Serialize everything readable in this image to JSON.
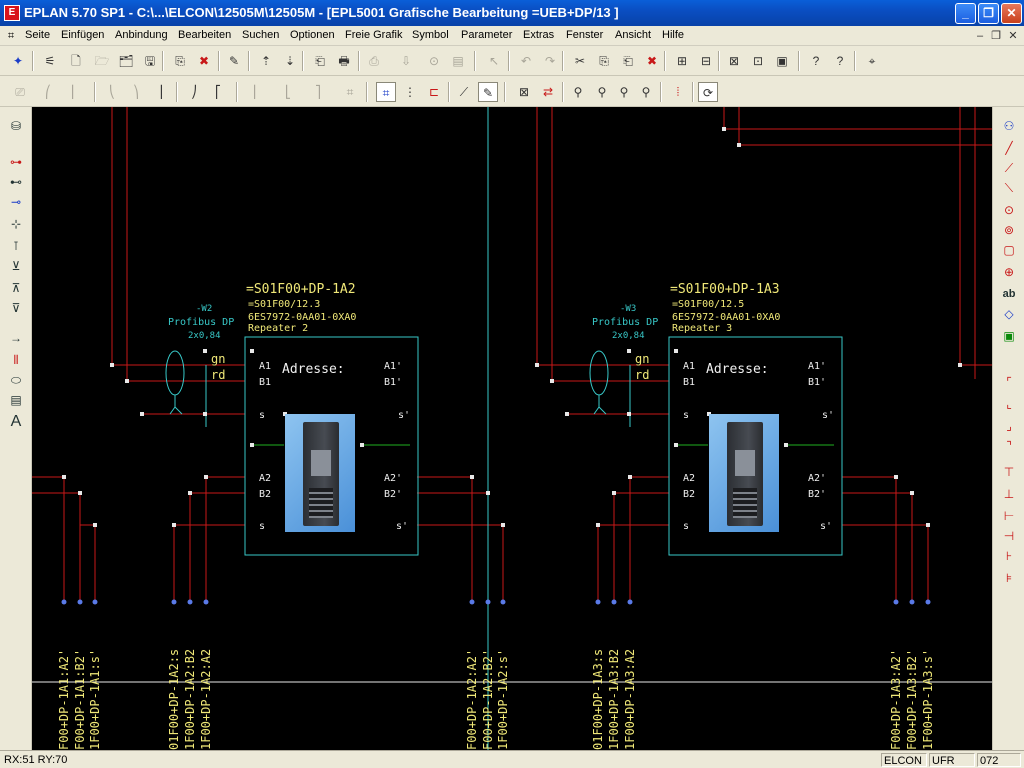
{
  "window": {
    "title": "EPLAN 5.70 SP1 - C:\\...\\ELCON\\12505M\\12505M - [EPL5001 Grafische Bearbeitung =UEB+DP/13    ]",
    "app_icon": "eplan-app-icon",
    "controls": {
      "minimize": "_",
      "maximize": "❐",
      "close": "✕"
    }
  },
  "menubar": {
    "items": [
      "Seite",
      "Einfügen",
      "Anbindung",
      "Bearbeiten",
      "Suchen",
      "Optionen",
      "Freie Grafik",
      "Symbol",
      "Parameter",
      "Extras",
      "Fenster",
      "Ansicht",
      "Hilfe"
    ],
    "mdi_controls": {
      "minimize": "–",
      "restore": "❐",
      "close": "✕"
    }
  },
  "toolbar1": {
    "buttons": [
      "✦",
      "⚟",
      "🗋",
      "🗁",
      "🗂",
      "🖫",
      "⎘",
      "✖",
      "✎",
      "⇡",
      "⇣",
      "⎗",
      "🖶",
      "⎙",
      "⇩",
      "⊙",
      "▤",
      "↖",
      "↶",
      "↷",
      "✂",
      "⎘",
      "⎗",
      "✖",
      "⊞",
      "⊟",
      "⊠",
      "⊡",
      "▣",
      "?",
      "?",
      "⌖"
    ]
  },
  "toolbar2": {
    "buttons": [
      "⎚",
      "⎛",
      "⎜",
      "⎝",
      "⎞",
      "⎟",
      "⎠",
      "⎡",
      "⎢",
      "⎣",
      "⎤",
      "⌗",
      "⋮",
      "⊏",
      "⟋",
      "✎",
      "⊠",
      "⇄",
      "⚲",
      "⚲",
      "⚲",
      "⚲",
      "⦙",
      "⟳"
    ]
  },
  "left_tools": [
    "⛁",
    "⊶",
    "⊷",
    "⊸",
    "⊹",
    "⊺",
    "⊻",
    "⊼",
    "⊽",
    "→",
    "⫴",
    "⬭",
    "▤",
    "A"
  ],
  "right_tools": [
    "⚇",
    "╱",
    "⟋",
    "⟍",
    "⊙",
    "⊚",
    "▢",
    "⊕",
    "ab",
    "◇",
    "▣",
    "⌜",
    "⌞",
    "⌟",
    "⌝",
    "⊤",
    "⊥",
    "⊢",
    "⊣",
    "⊦",
    "⊧"
  ],
  "schematic": {
    "devices": [
      {
        "name": "=S01F00+DP-1A2",
        "ref": "=S01F00/12.3",
        "order": "6ES7972-0AA01-0XA0",
        "type": "Repeater 2",
        "cable": "-W2",
        "cable_type": "Profibus DP",
        "cable_size": "2x0,84",
        "label": "Adresse:",
        "pins_left": [
          "A1",
          "B1",
          "s",
          "A2",
          "B2",
          "s"
        ],
        "pins_right": [
          "A1'",
          "B1'",
          "s'",
          "A2'",
          "B2'",
          "s'"
        ],
        "wire_colors": [
          "gn",
          "rd"
        ]
      },
      {
        "name": "=S01F00+DP-1A3",
        "ref": "=S01F00/12.5",
        "order": "6ES7972-0AA01-0XA0",
        "type": "Repeater 3",
        "cable": "-W3",
        "cable_type": "Profibus DP",
        "cable_size": "2x0,84",
        "label": "Adresse:",
        "pins_left": [
          "A1",
          "B1",
          "s",
          "A2",
          "B2",
          "s"
        ],
        "pins_right": [
          "A1'",
          "B1'",
          "s'",
          "A2'",
          "B2'",
          "s'"
        ],
        "wire_colors": [
          "gn",
          "rd"
        ]
      }
    ],
    "references": [
      "F00+DP-1A1:A2'",
      "F00+DP-1A1:B2'",
      "1F00+DP-1A1:s'",
      "01F00+DP-1A2:s",
      "1F00+DP-1A2:B2",
      "1F00+DP-1A2:A2",
      "F00+DP-1A2:A2'",
      "F00+DP-1A2:B2'",
      "1F00+DP-1A2:s'",
      "01F00+DP-1A3:s",
      "1F00+DP-1A3:B2",
      "1F00+DP-1A3:A2",
      "F00+DP-1A3:A2'",
      "F00+DP-1A3:B2'",
      "1F00+DP-1A3:s'"
    ],
    "colors": {
      "background": "#000000",
      "wire": "#c81818",
      "box": "#38c8c8",
      "text": "#f0e878",
      "pin_text": "#f0f0f0",
      "bus": "#20b020"
    }
  },
  "status": {
    "coords": "RX:51 RY:70",
    "project": "ELCON",
    "mode": "UFR",
    "page": "072"
  }
}
